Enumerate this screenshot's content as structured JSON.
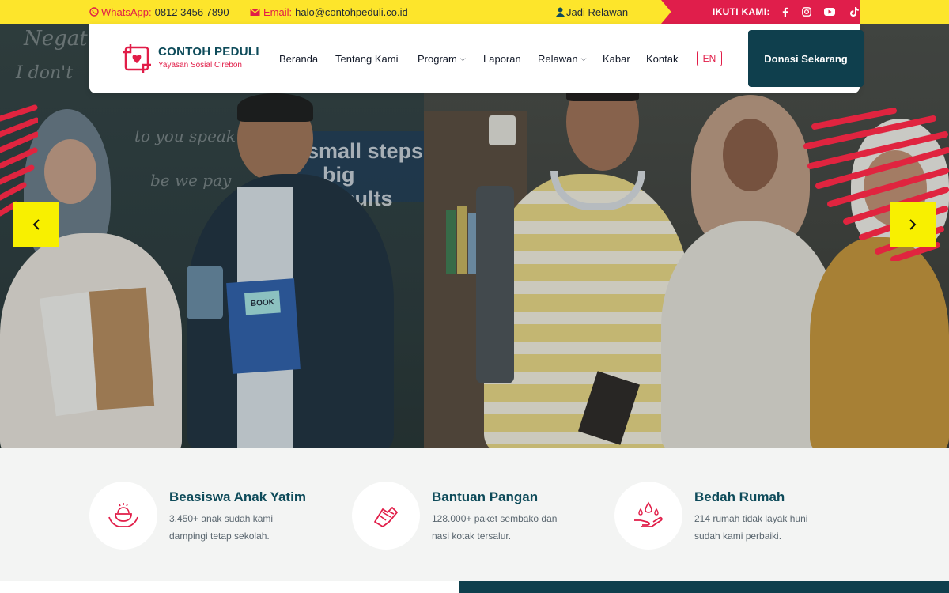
{
  "topbar": {
    "whatsapp_label": "WhatsApp:",
    "whatsapp_value": "0812 3456 7890",
    "email_label": "Email:",
    "email_value": "halo@contohpeduli.co.id",
    "volunteer_link": "Jadi Relawan",
    "follow_label": "IKUTI KAMI:",
    "socials": [
      "facebook-icon",
      "instagram-icon",
      "youtube-icon",
      "tiktok-icon"
    ]
  },
  "header": {
    "brand_name": "CONTOH PEDULI",
    "brand_tagline": "Yayasan Sosial Cirebon",
    "nav": {
      "home": "Beranda",
      "about": "Tentang Kami",
      "program": "Program",
      "reports": "Laporan",
      "volunteer": "Relawan",
      "news": "Kabar",
      "contact": "Kontak"
    },
    "language": "EN",
    "donate_button": "Donasi Sekarang"
  },
  "hero": {
    "board_lines": [
      "small steps",
      "big results"
    ],
    "book_label": "BOOK"
  },
  "features": [
    {
      "icon": "rice-bowl-hands-icon",
      "title": "Beasiswa Anak Yatim",
      "desc": "3.450+ anak sudah kami dampingi tetap sekolah."
    },
    {
      "icon": "helping-hands-icon",
      "title": "Bantuan Pangan",
      "desc": "128.000+ paket sembako dan nasi kotak tersalur."
    },
    {
      "icon": "water-drop-hand-icon",
      "title": "Bedah Rumah",
      "desc": "214 rumah tidak layak huni sudah kami perbaiki."
    }
  ],
  "colors": {
    "topbar_yellow": "#fde52b",
    "accent_red": "#e11d48",
    "brand_teal": "#0f3f4d",
    "arrow_yellow": "#f8f000"
  }
}
